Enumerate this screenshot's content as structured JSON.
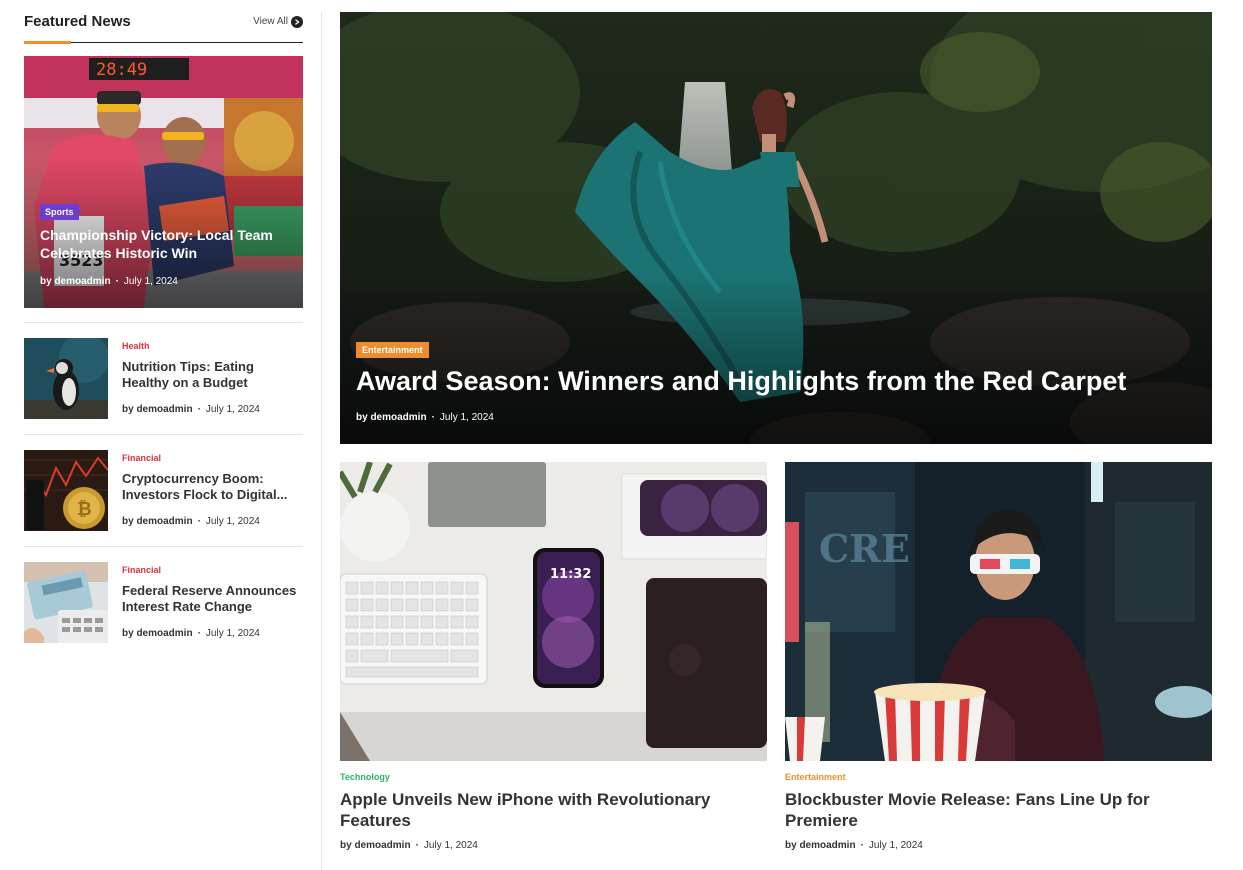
{
  "sidebar": {
    "title": "Featured News",
    "view_all": "View All",
    "featured": {
      "category": "Sports",
      "headline": "Championship Victory: Local Team Celebrates Historic Win",
      "author": "by demoadmin",
      "date": "July 1, 2024"
    },
    "items": [
      {
        "category": "Health",
        "headline": "Nutrition Tips: Eating Healthy on a Budget",
        "author": "by demoadmin",
        "date": "July 1, 2024"
      },
      {
        "category": "Financial",
        "headline": "Cryptocurrency Boom: Investors Flock to Digital...",
        "author": "by demoadmin",
        "date": "July 1, 2024"
      },
      {
        "category": "Financial",
        "headline": "Federal Reserve Announces Interest Rate Change",
        "author": "by demoadmin",
        "date": "July 1, 2024"
      }
    ]
  },
  "main": {
    "hero": {
      "category": "Entertainment",
      "headline": "Award Season: Winners and Highlights from the Red Carpet",
      "author": "by demoadmin",
      "date": "July 1, 2024"
    },
    "cards": [
      {
        "category": "Technology",
        "headline": "Apple Unveils New iPhone with Revolutionary Features",
        "author": "by demoadmin",
        "date": "July 1, 2024"
      },
      {
        "category": "Entertainment",
        "headline": "Blockbuster Movie Release: Fans Line Up for Premiere",
        "author": "by demoadmin",
        "date": "July 1, 2024"
      }
    ]
  },
  "phone_clock": "11:32",
  "colors": {
    "accent": "#f08c2b",
    "sports": "#6c3dd1",
    "health": "#d9333f",
    "financial": "#d9333f",
    "technology": "#2fb36a",
    "entertainment": "#f08c2b"
  }
}
